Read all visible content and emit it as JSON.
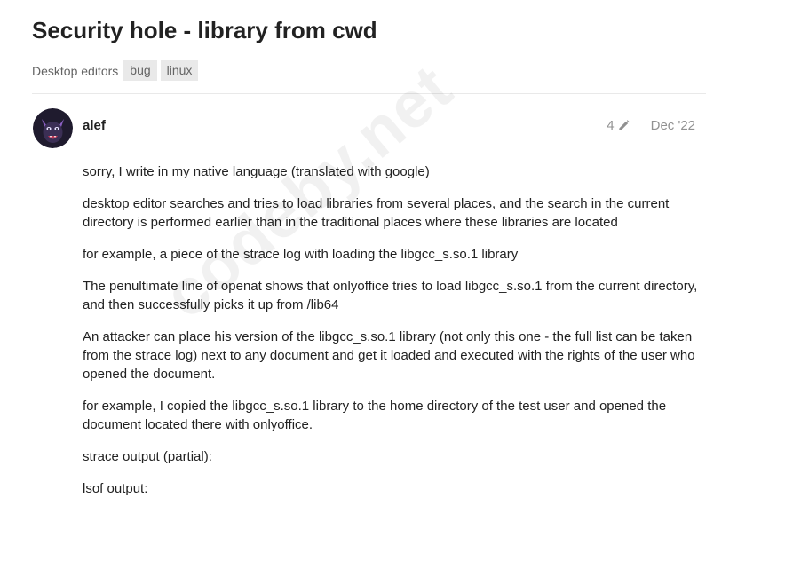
{
  "topic": {
    "title": "Security hole - library from cwd",
    "category": "Desktop editors",
    "tags": [
      "bug",
      "linux"
    ]
  },
  "post": {
    "username": "alef",
    "edit_count": "4",
    "date": "Dec '22",
    "paragraphs": [
      "sorry, I write in my native language (translated with google)",
      "desktop editor searches and tries to load libraries from several places, and the search in the current directory is performed earlier than in the traditional places where these libraries are located",
      "for example, a piece of the strace log with loading the libgcc_s.so.1 library",
      "The penultimate line of openat shows that onlyoffice tries to load libgcc_s.so.1 from the current directory, and then successfully picks it up from /lib64",
      "An attacker can place his version of the libgcc_s.so.1 library (not only this one - the full list can be taken from the strace log) next to any document and get it loaded and executed with the rights of the user who opened the document.",
      "for example, I copied the libgcc_s.so.1 library to the home directory of the test user and opened the document located there with onlyoffice.",
      "strace output (partial):",
      "lsof output:"
    ]
  },
  "watermark": "codeby.net",
  "icons": {
    "avatar": "avatar-dark-creature",
    "edit": "pencil-icon"
  },
  "colors": {
    "tag_bg": "#e9e9e9",
    "muted_text": "#919191",
    "avatar_bg": "#1f1b2e",
    "avatar_accent": "#8a5fc2"
  }
}
